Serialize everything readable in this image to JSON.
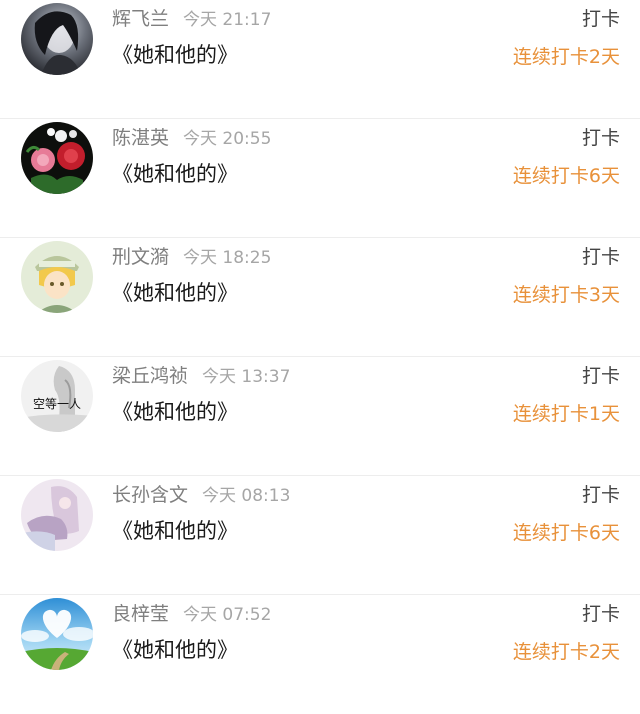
{
  "posts": [
    {
      "name": "辉飞兰",
      "time": "今天 21:17",
      "content": "《她和他的》",
      "action": "打卡",
      "streak": "连续打卡2天",
      "avatar": "dark-girl-portrait"
    },
    {
      "name": "陈湛英",
      "time": "今天 20:55",
      "content": "《她和他的》",
      "action": "打卡",
      "streak": "连续打卡6天",
      "avatar": "roses"
    },
    {
      "name": "刑文漪",
      "time": "今天 18:25",
      "content": "《她和他的》",
      "action": "打卡",
      "streak": "连续打卡3天",
      "avatar": "anime-boy"
    },
    {
      "name": "梁丘鸿祯",
      "time": "今天 13:37",
      "content": "《她和他的》",
      "action": "打卡",
      "streak": "连续打卡1天",
      "avatar": "text-avatar",
      "avatar_text": "空等一人"
    },
    {
      "name": "长孙含文",
      "time": "今天 08:13",
      "content": "《她和他的》",
      "action": "打卡",
      "streak": "连续打卡6天",
      "avatar": "pastel-figure"
    },
    {
      "name": "良梓莹",
      "time": "今天 07:52",
      "content": "《她和他的》",
      "action": "打卡",
      "streak": "连续打卡2天",
      "avatar": "sky-heart-landscape"
    }
  ]
}
